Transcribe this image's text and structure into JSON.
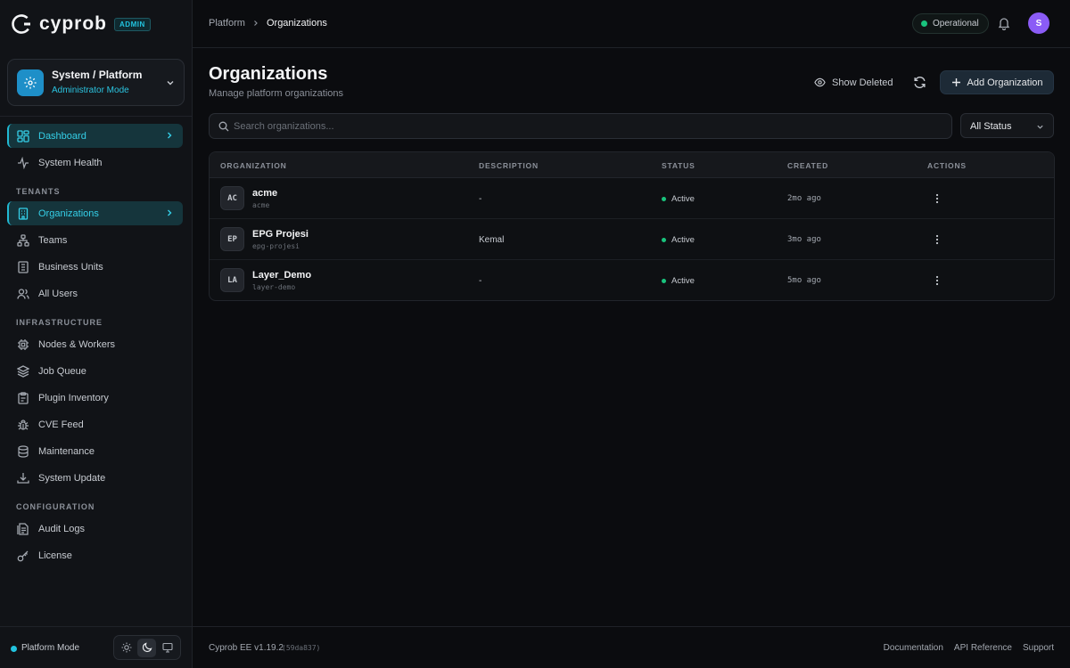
{
  "brand": {
    "name": "cyprob",
    "badge": "ADMIN"
  },
  "context": {
    "title": "System / Platform",
    "subtitle": "Administrator Mode"
  },
  "nav": {
    "top": [
      {
        "label": "Dashboard",
        "icon": "dashboard-icon",
        "active": true
      },
      {
        "label": "System Health",
        "icon": "activity-icon",
        "active": false
      }
    ],
    "tenants_heading": "TENANTS",
    "tenants": [
      {
        "label": "Organizations",
        "icon": "building-icon",
        "active": true
      },
      {
        "label": "Teams",
        "icon": "teams-icon",
        "active": false
      },
      {
        "label": "Business Units",
        "icon": "business-units-icon",
        "active": false
      },
      {
        "label": "All Users",
        "icon": "users-icon",
        "active": false
      }
    ],
    "infra_heading": "INFRASTRUCTURE",
    "infra": [
      {
        "label": "Nodes & Workers",
        "icon": "cpu-icon"
      },
      {
        "label": "Job Queue",
        "icon": "layers-icon"
      },
      {
        "label": "Plugin Inventory",
        "icon": "clipboard-icon"
      },
      {
        "label": "CVE Feed",
        "icon": "bug-icon"
      },
      {
        "label": "Maintenance",
        "icon": "database-icon"
      },
      {
        "label": "System Update",
        "icon": "download-icon"
      }
    ],
    "config_heading": "CONFIGURATION",
    "config": [
      {
        "label": "Audit Logs",
        "icon": "audit-log-icon"
      },
      {
        "label": "License",
        "icon": "key-icon"
      }
    ]
  },
  "sidebar_footer": {
    "mode": "Platform Mode"
  },
  "topbar": {
    "breadcrumb": [
      "Platform",
      "Organizations"
    ],
    "status": "Operational",
    "avatar_initial": "S"
  },
  "page": {
    "title": "Organizations",
    "subtitle": "Manage platform organizations",
    "show_deleted": "Show Deleted",
    "add_button": "Add Organization"
  },
  "search": {
    "placeholder": "Search organizations..."
  },
  "filter": {
    "selected": "All Status"
  },
  "table": {
    "columns": [
      "ORGANIZATION",
      "DESCRIPTION",
      "STATUS",
      "CREATED",
      "ACTIONS"
    ],
    "rows": [
      {
        "initials": "AC",
        "name": "acme",
        "slug": "acme",
        "description": "-",
        "status": "Active",
        "created": "2mo ago"
      },
      {
        "initials": "EP",
        "name": "EPG Projesi",
        "slug": "epg-projesi",
        "description": "Kemal",
        "status": "Active",
        "created": "3mo ago"
      },
      {
        "initials": "LA",
        "name": "Layer_Demo",
        "slug": "layer-demo",
        "description": "-",
        "status": "Active",
        "created": "5mo ago"
      }
    ]
  },
  "footer": {
    "version": "Cyprob EE v1.19.2",
    "hash": "(59da837)",
    "links": [
      "Documentation",
      "API Reference",
      "Support"
    ]
  },
  "colors": {
    "accent": "#22c3df",
    "status_ok": "#19c37d",
    "avatar": "#8b5cf6"
  }
}
